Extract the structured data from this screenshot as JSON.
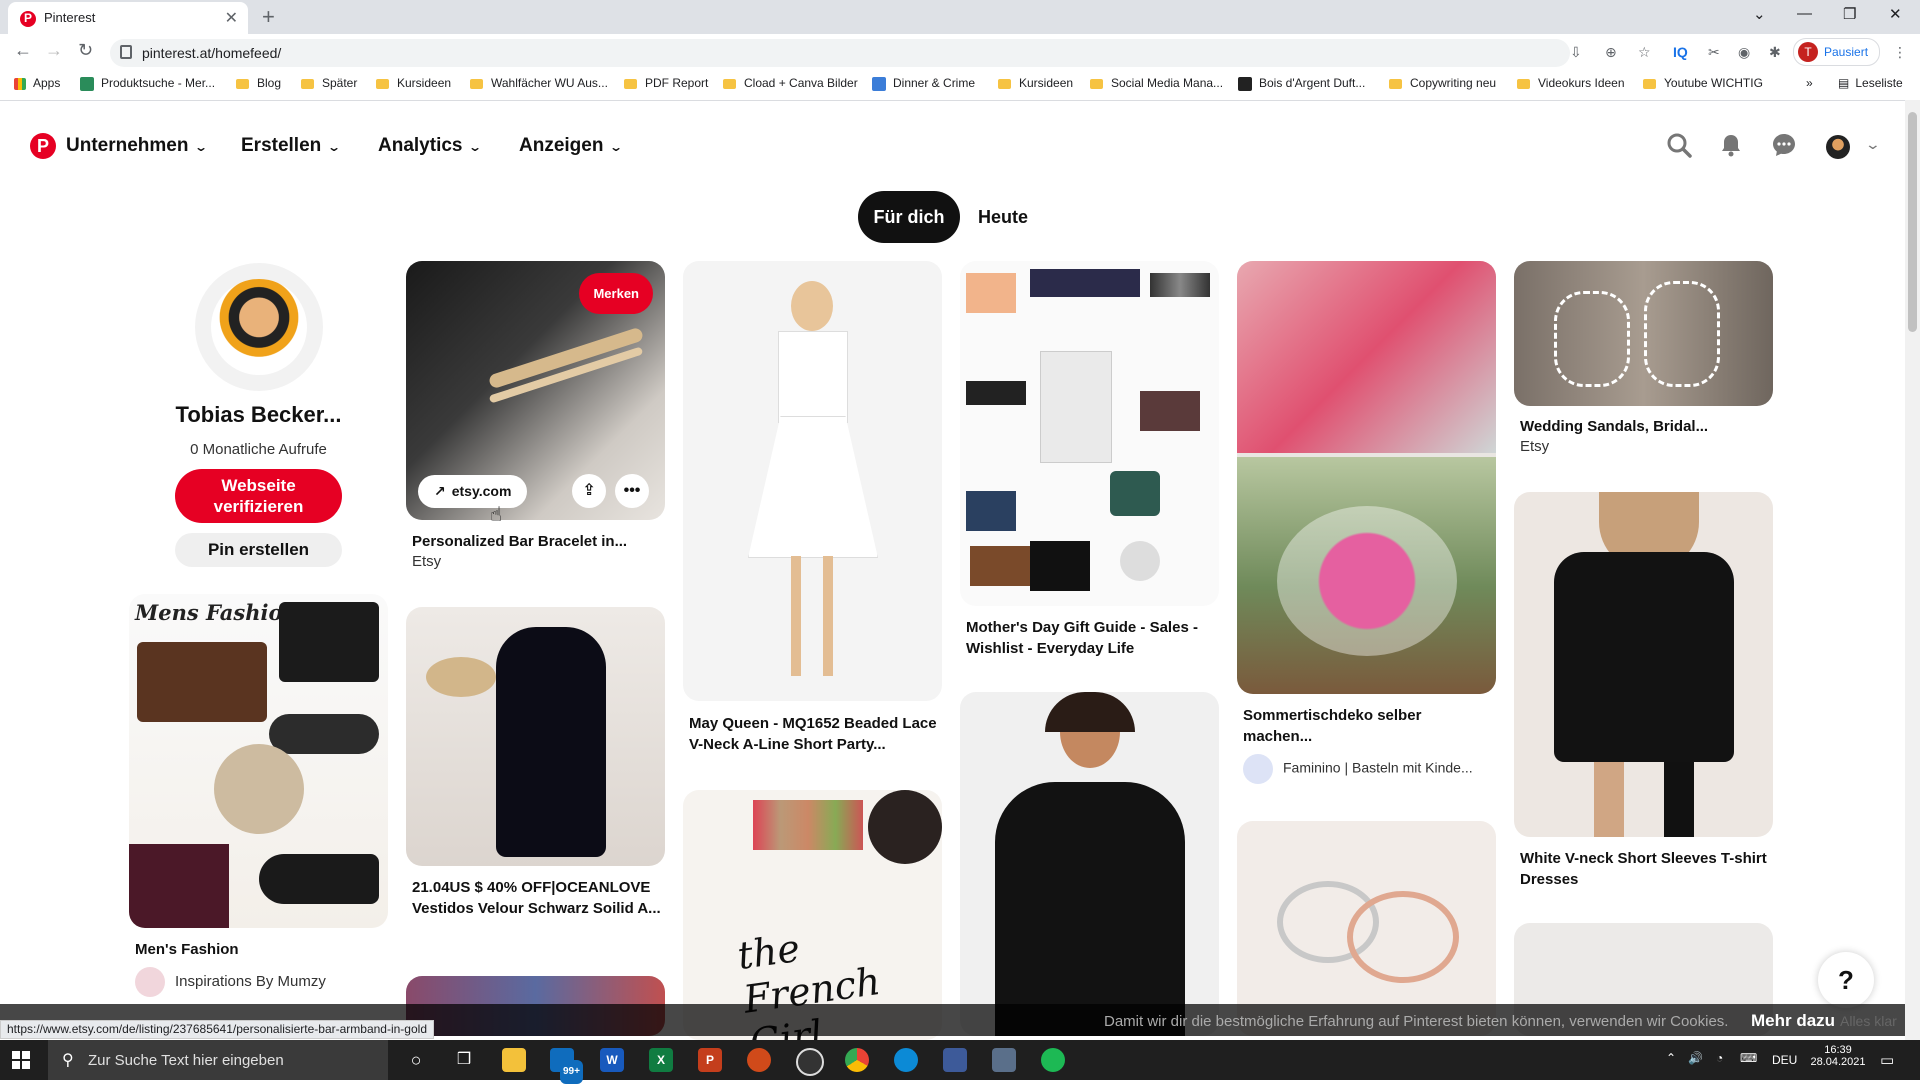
{
  "browser": {
    "tab_title": "Pinterest",
    "url": "pinterest.at/homefeed/",
    "profile_initial": "T",
    "profile_label": "Pausiert",
    "bookmarks": [
      "Apps",
      "Produktsuche - Mer...",
      "Blog",
      "Später",
      "Kursideen",
      "Wahlfächer WU Aus...",
      "PDF Report",
      "Cload + Canva Bilder",
      "Dinner & Crime",
      "Kursideen",
      "Social Media Mana...",
      "Bois d'Argent Duft...",
      "Copywriting neu",
      "Videokurs Ideen",
      "Youtube WICHTIG"
    ],
    "reading_list": "Leseliste",
    "status_url": "https://www.etsy.com/de/listing/237685641/personalisierte-bar-armband-in-gold"
  },
  "header": {
    "logo": "P",
    "nav": [
      "Unternehmen",
      "Erstellen",
      "Analytics",
      "Anzeigen"
    ]
  },
  "tabs": {
    "active": "Für dich",
    "inactive": "Heute"
  },
  "profile": {
    "name": "Tobias Becker...",
    "views": "0 Monatliche Aufrufe",
    "verify_button": "Webseite verifizieren",
    "create_pin": "Pin erstellen"
  },
  "pins": {
    "bracelet": {
      "title": "Personalized Bar Bracelet in...",
      "source": "Etsy",
      "save": "Merken",
      "link": "etsy.com"
    },
    "dress_white": {
      "title": "May Queen - MQ1652 Beaded Lace V-Neck A-Line Short Party..."
    },
    "mothers_day": {
      "title": "Mother's Day Gift Guide - Sales - Wishlist - Everyday Life"
    },
    "tischdeko": {
      "title": "Sommertischdeko selber machen...",
      "source": "Faminino | Basteln mit Kinde..."
    },
    "sandals": {
      "title": "Wedding Sandals, Bridal...",
      "source": "Etsy"
    },
    "mens_fashion": {
      "title": "Men's Fashion",
      "source": "Inspirations By Mumzy",
      "overlay": "Mens Fashion Guide"
    },
    "velvet_dress": {
      "title": "21.04US $ 40% OFF|OCEANLOVE Vestidos Velour Schwarz Soilid A..."
    },
    "french_girl": {
      "overlay": "the French Girl"
    },
    "tshirt_dress": {
      "title": "White V-neck Short Sleeves T-shirt Dresses"
    }
  },
  "cookie": {
    "text": "Damit wir dir die bestmögliche Erfahrung auf Pinterest bieten können, verwenden wir Cookies.",
    "more": "Mehr dazu",
    "ok": "Alles klar"
  },
  "help": "?",
  "taskbar": {
    "search_placeholder": "Zur Suche Text hier eingeben",
    "mail_badge": "99+",
    "language": "DEU",
    "time": "16:39",
    "date": "28.04.2021"
  }
}
